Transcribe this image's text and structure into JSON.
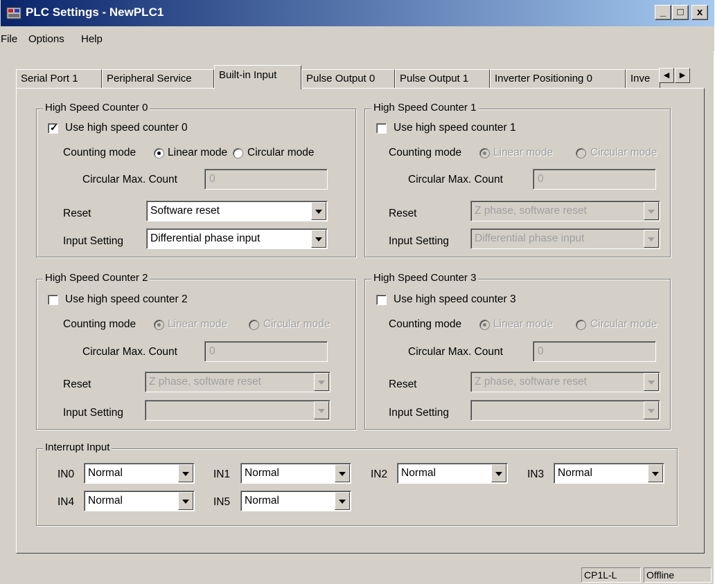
{
  "window": {
    "title": "PLC Settings - NewPLC1",
    "minimize": "_",
    "maximize": "□",
    "close": "x"
  },
  "menu": [
    "File",
    "Options",
    "Help"
  ],
  "tabs": [
    "Serial Port 1",
    "Peripheral Service",
    "Built-in Input",
    "Pulse Output 0",
    "Pulse Output 1",
    "Inverter Positioning 0",
    "Inve"
  ],
  "active_tab": "Built-in Input",
  "tab_scroll": {
    "left": "◀",
    "right": "▶"
  },
  "labels": {
    "counting_mode": "Counting mode",
    "linear_mode": "Linear mode",
    "circular_mode": "Circular mode",
    "circular_max": "Circular Max. Count",
    "reset": "Reset",
    "input_setting": "Input Setting"
  },
  "counters": [
    {
      "title": "High Speed Counter 0",
      "use_label": "Use high speed counter 0",
      "checked": true,
      "mode": "Linear",
      "max_count": "0",
      "reset": "Software reset",
      "input_setting": "Differential phase input"
    },
    {
      "title": "High Speed Counter 1",
      "use_label": "Use high speed counter 1",
      "checked": false,
      "mode": "Linear",
      "max_count": "0",
      "reset": "Z phase, software reset",
      "input_setting": "Differential phase input"
    },
    {
      "title": "High Speed Counter 2",
      "use_label": "Use high speed counter 2",
      "checked": false,
      "mode": "Linear",
      "max_count": "0",
      "reset": "Z phase, software reset",
      "input_setting": ""
    },
    {
      "title": "High Speed Counter 3",
      "use_label": "Use high speed counter 3",
      "checked": false,
      "mode": "Linear",
      "max_count": "0",
      "reset": "Z phase, software reset",
      "input_setting": ""
    }
  ],
  "interrupt": {
    "title": "Interrupt Input",
    "inputs": [
      {
        "label": "IN0",
        "value": "Normal"
      },
      {
        "label": "IN1",
        "value": "Normal"
      },
      {
        "label": "IN2",
        "value": "Normal"
      },
      {
        "label": "IN3",
        "value": "Normal"
      },
      {
        "label": "IN4",
        "value": "Normal"
      },
      {
        "label": "IN5",
        "value": "Normal"
      }
    ]
  },
  "status": {
    "model": "CP1L-L",
    "connection": "Offline"
  }
}
